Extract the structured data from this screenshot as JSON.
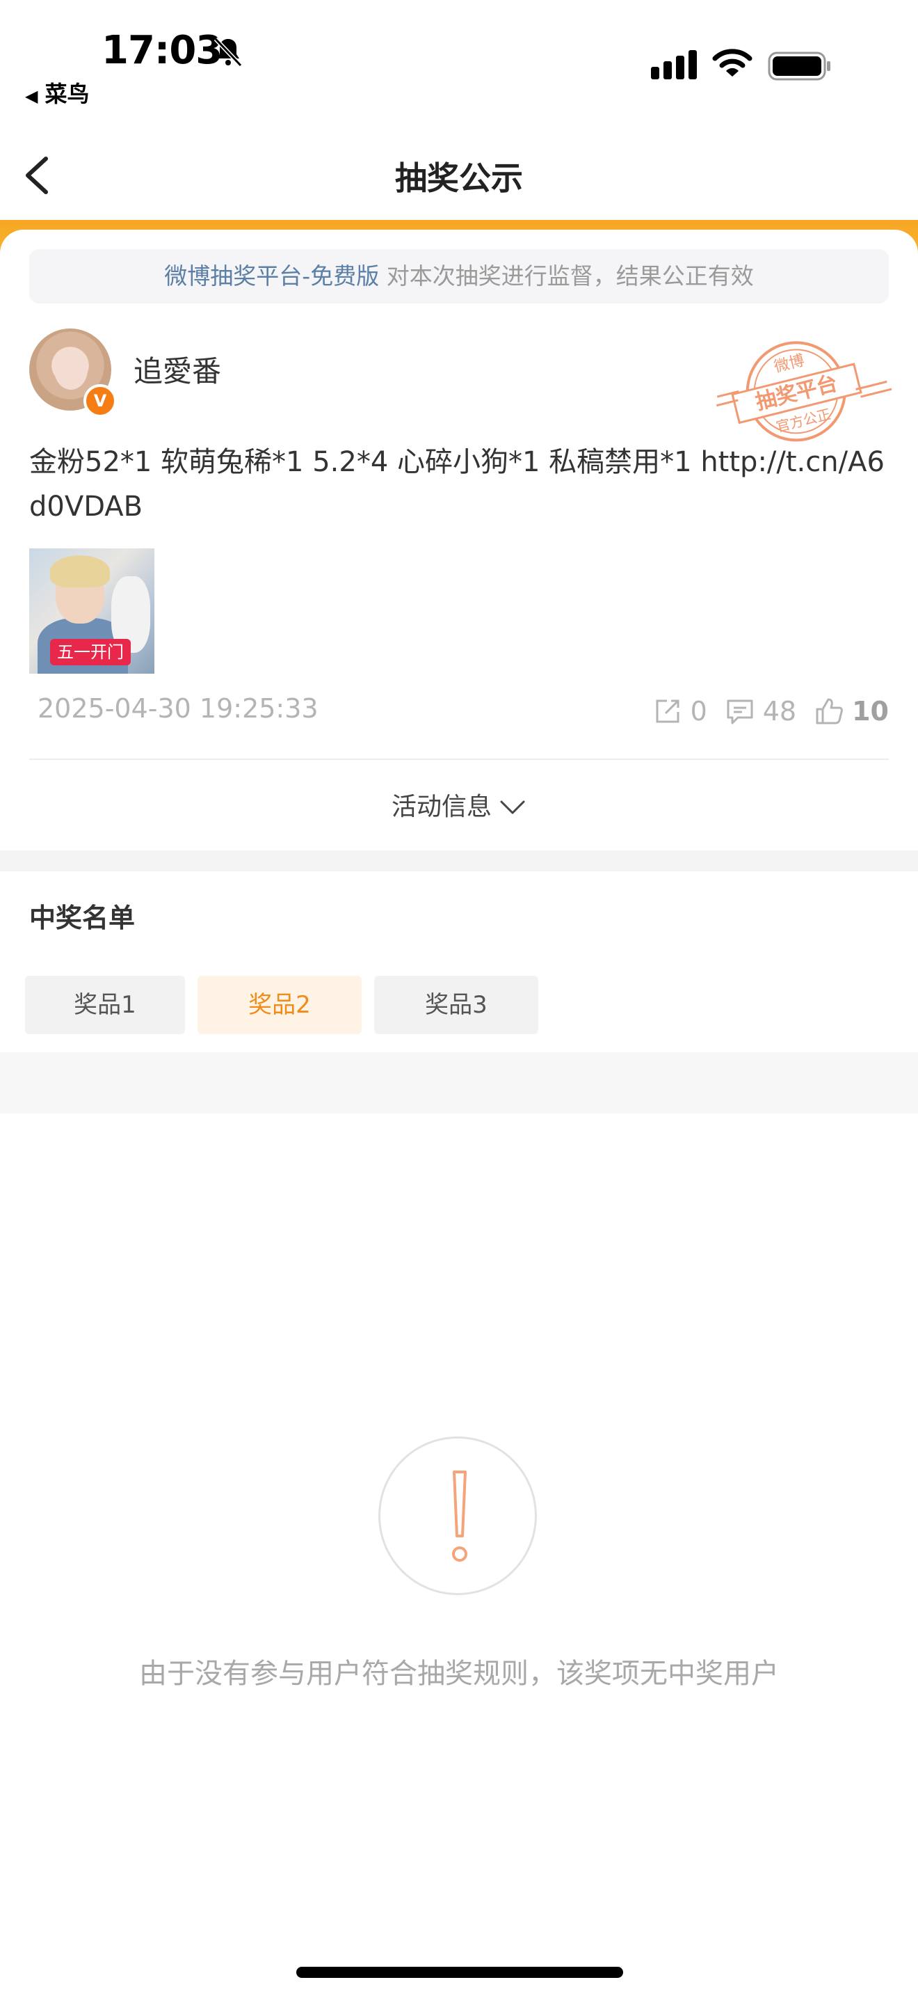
{
  "status_bar": {
    "time": "17:03",
    "back_app_label": "菜鸟",
    "icons": [
      "bell-slash-icon",
      "signal-icon",
      "wifi-icon",
      "battery-icon"
    ]
  },
  "nav": {
    "title": "抽奖公示",
    "back_icon": "chevron-left-icon"
  },
  "colors": {
    "accent_orange": "#f6a623",
    "active_tab_text": "#f08c1a",
    "verify_badge": "#f57d14",
    "link_blue": "#5b7fa6"
  },
  "banner": {
    "platform_link": "微博抽奖平台-免费版",
    "description": " 对本次抽奖进行监督，结果公正有效"
  },
  "post": {
    "author": "追愛番",
    "stamp": {
      "top": "微博",
      "middle": "抽奖平台",
      "bottom": "官方公正"
    },
    "text": "金粉52*1 软萌兔稀*1 5.2*4 心碎小狗*1 私稿禁用*1   http://t.cn/A6d0VDAB",
    "image_tag": "五一开门",
    "date": "2025-04-30 19:25:33",
    "reposts": "0",
    "comments": "48",
    "likes": "10"
  },
  "activity_info": {
    "label": "活动信息"
  },
  "winners": {
    "title": "中奖名单",
    "tabs": [
      {
        "label": "奖品1",
        "active": false
      },
      {
        "label": "奖品2",
        "active": true
      },
      {
        "label": "奖品3",
        "active": false
      }
    ]
  },
  "empty_state": {
    "icon": "exclamation-icon",
    "message": "由于没有参与用户符合抽奖规则，该奖项无中奖用户"
  }
}
